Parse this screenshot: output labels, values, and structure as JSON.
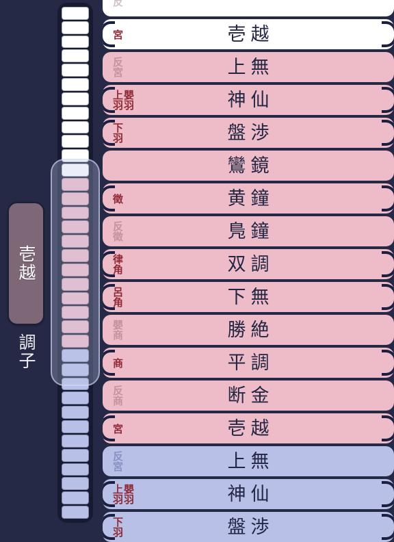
{
  "app": {
    "background_color": "#252946",
    "row_colors": {
      "white": "#ffffff",
      "pink": "#eebcc8",
      "blue": "#b9c0e8"
    },
    "accent_label_color": "#8f2b36",
    "tab_color": "#7e6878"
  },
  "sidebar": {
    "mode_tab_label": "壱越",
    "mode_caption": "調子"
  },
  "minimap": {
    "cells": [
      "w",
      "w",
      "w",
      "w",
      "w",
      "w",
      "w",
      "w",
      "w",
      "w",
      "w",
      "w",
      "p",
      "p",
      "p",
      "p",
      "p",
      "p",
      "p",
      "p",
      "p",
      "p",
      "p",
      "p",
      "b",
      "b",
      "b",
      "b",
      "b",
      "b",
      "b",
      "b",
      "b",
      "b",
      "b",
      "b"
    ],
    "viewport_top_index": 10,
    "viewport_span": 17
  },
  "list": {
    "rows": [
      {
        "color": "white",
        "marked": false,
        "faded": true,
        "degrees": [
          "反"
        ],
        "name": ""
      },
      {
        "color": "white",
        "marked": true,
        "faded": false,
        "degrees": [
          "宮"
        ],
        "name": "壱越"
      },
      {
        "color": "pink",
        "marked": false,
        "faded": true,
        "degrees": [
          "反宮"
        ],
        "name": "上無"
      },
      {
        "color": "pink",
        "marked": true,
        "faded": false,
        "degrees": [
          "上羽",
          "嬰羽"
        ],
        "name": "神仙"
      },
      {
        "color": "pink",
        "marked": true,
        "faded": false,
        "degrees": [
          "下羽"
        ],
        "name": "盤渉"
      },
      {
        "color": "pink",
        "marked": false,
        "faded": false,
        "degrees": [],
        "name": "鸞鏡"
      },
      {
        "color": "pink",
        "marked": true,
        "faded": false,
        "degrees": [
          "徵"
        ],
        "name": "黄鐘"
      },
      {
        "color": "pink",
        "marked": false,
        "faded": true,
        "degrees": [
          "反徵"
        ],
        "name": "鳬鐘"
      },
      {
        "color": "pink",
        "marked": true,
        "faded": false,
        "degrees": [
          "律角"
        ],
        "name": "双調"
      },
      {
        "color": "pink",
        "marked": true,
        "faded": false,
        "degrees": [
          "呂角"
        ],
        "name": "下無"
      },
      {
        "color": "pink",
        "marked": false,
        "faded": true,
        "degrees": [
          "嬰商"
        ],
        "name": "勝絶"
      },
      {
        "color": "pink",
        "marked": true,
        "faded": false,
        "degrees": [
          "商"
        ],
        "name": "平調"
      },
      {
        "color": "pink",
        "marked": false,
        "faded": true,
        "degrees": [
          "反商"
        ],
        "name": "断金"
      },
      {
        "color": "pink",
        "marked": true,
        "faded": false,
        "degrees": [
          "宮"
        ],
        "name": "壱越"
      },
      {
        "color": "blue",
        "marked": false,
        "faded": true,
        "degrees": [
          "反宮"
        ],
        "name": "上無"
      },
      {
        "color": "blue",
        "marked": true,
        "faded": false,
        "degrees": [
          "上羽",
          "嬰羽"
        ],
        "name": "神仙"
      },
      {
        "color": "blue",
        "marked": true,
        "faded": false,
        "degrees": [
          "下羽"
        ],
        "name": "盤渉"
      }
    ]
  }
}
